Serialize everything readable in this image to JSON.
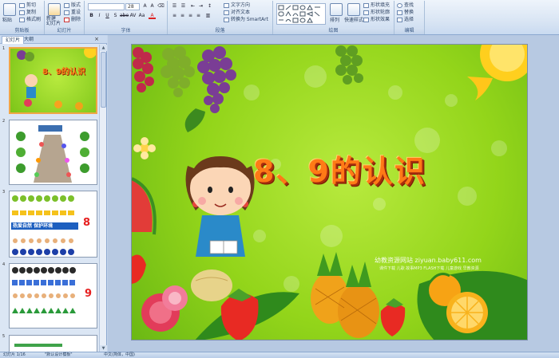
{
  "ribbon": {
    "clipboard": {
      "label": "剪贴板",
      "paste": "粘贴",
      "cut": "剪切",
      "copy": "复制",
      "format_painter": "格式刷"
    },
    "slides": {
      "label": "幻灯片",
      "new_slide": "新建\n幻灯片",
      "layout": "版式",
      "reset": "重设",
      "delete": "删除"
    },
    "font": {
      "label": "字体",
      "font_name": "",
      "font_size": "28"
    },
    "paragraph": {
      "label": "段落",
      "text_direction": "文字方向",
      "align_text": "对齐文本",
      "smartart": "转换为 SmartArt"
    },
    "drawing": {
      "label": "绘图",
      "arrange": "排列",
      "quick_styles": "快速样式",
      "shape_fill": "形状填充",
      "shape_outline": "形状轮廓",
      "shape_effects": "形状效果"
    },
    "editing": {
      "label": "编辑",
      "find": "查找",
      "replace": "替换",
      "select": "选择"
    }
  },
  "panel": {
    "tab_slides": "幻灯片",
    "tab_outline": "大纲",
    "close": "×",
    "slide_numbers": [
      "1",
      "2",
      "3",
      "4",
      "5"
    ]
  },
  "thumbnails": {
    "slide1_title": "8、9的认识",
    "slide3_text": "热爱自然 保护环境",
    "slide3_number": "8",
    "slide4_number": "9"
  },
  "slide": {
    "title": "8、9的认识",
    "watermark_main": "幼教资源网站  ziyuan.baby611.com",
    "watermark_sub": "课件下载 儿歌 故事MP3 FLASH下载 儿童游戏 早教资源"
  },
  "status": {
    "slide_info": "幻灯片 1/16",
    "theme": "\"默认设计模板\"",
    "language": "中文(简体，中国)"
  },
  "colors": {
    "ribbon_bg": "#d6e3f3",
    "slide_bg": "#93d51a",
    "title_orange": "#ff7a16",
    "selection_orange": "#f0a646"
  }
}
